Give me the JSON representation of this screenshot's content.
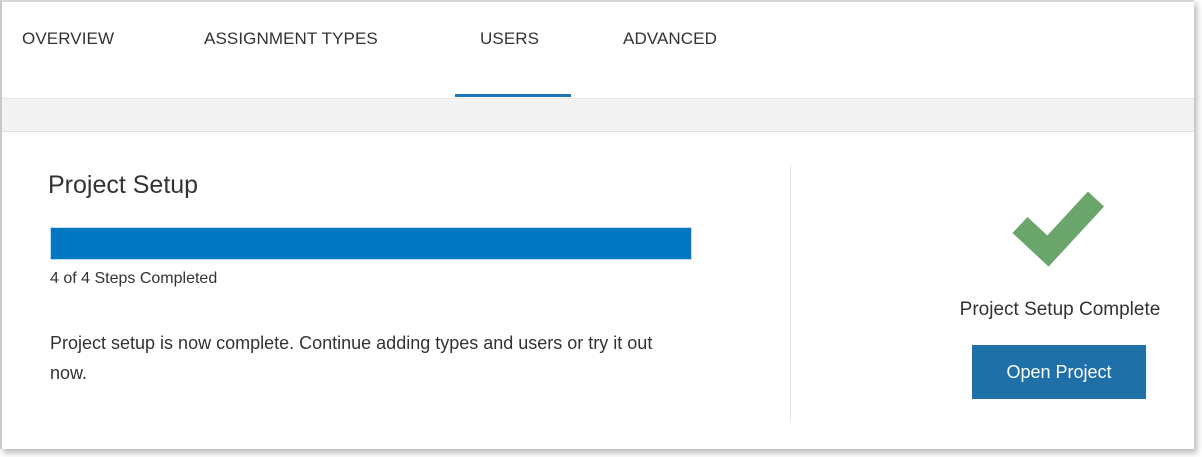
{
  "tabs": [
    {
      "label": "OVERVIEW",
      "active": false
    },
    {
      "label": "ASSIGNMENT TYPES",
      "active": false
    },
    {
      "label": "USERS",
      "active": true
    },
    {
      "label": "ADVANCED",
      "active": false
    }
  ],
  "setup": {
    "title": "Project Setup",
    "steps_completed": 4,
    "steps_total": 4,
    "progress_fraction": 1.0,
    "steps_text": "4 of 4 Steps Completed",
    "description": "Project setup is now complete. Continue adding types and users or try it out now."
  },
  "status": {
    "icon": "checkmark-icon",
    "check_color": "#6aa56b",
    "text": "Project Setup Complete",
    "button_label": "Open Project"
  },
  "colors": {
    "accent": "#1b75bb",
    "progress": "#0077c0",
    "button": "#1f6fa8"
  }
}
